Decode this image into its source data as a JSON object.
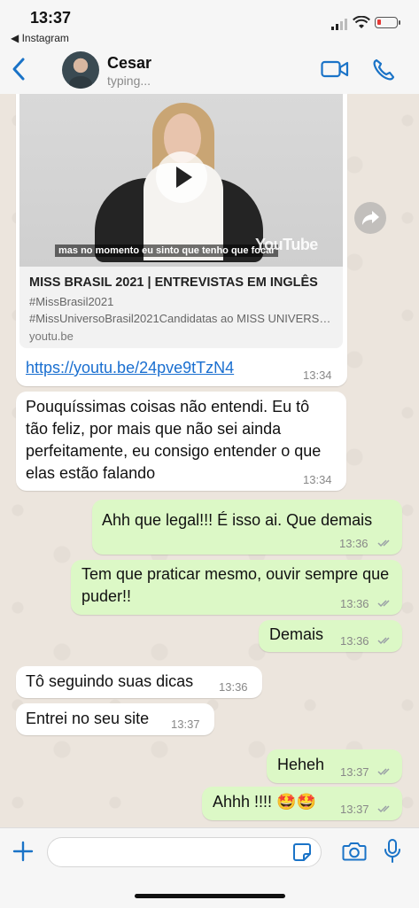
{
  "status_bar": {
    "time": "13:37",
    "back_app": "◀ Instagram"
  },
  "header": {
    "contact_name": "Cesar",
    "contact_status": "typing..."
  },
  "link_preview": {
    "video_caption": "mas no momento eu sinto que tenho que focar",
    "yt_logo": "YouTube",
    "title": "MISS BRASIL 2021 | ENTREVISTAS EM INGLÊS",
    "desc1": "#MissBrasil2021",
    "desc2": "#MissUniversoBrasil2021Candidatas ao MISS UNIVERSO...",
    "domain": "youtu.be",
    "url": "https://youtu.be/24pve9tTzN4",
    "time": "13:34"
  },
  "messages": [
    {
      "dir": "in",
      "text": "Pouquíssimas coisas não entendi. Eu tô tão feliz, por mais que não sei ainda perfeitamente, eu consigo entender o que elas estão falando",
      "time": "13:34"
    },
    {
      "dir": "out",
      "text": "Ahh que legal!!! É isso ai. Que demais",
      "time": "13:36"
    },
    {
      "dir": "out",
      "text": "Tem que praticar mesmo, ouvir sempre que puder!!",
      "time": "13:36"
    },
    {
      "dir": "out",
      "text": "Demais",
      "time": "13:36"
    },
    {
      "dir": "in",
      "text": "Tô seguindo suas dicas",
      "time": "13:36"
    },
    {
      "dir": "in",
      "text": "Entrei no seu site",
      "time": "13:37"
    },
    {
      "dir": "out",
      "text": "Heheh",
      "time": "13:37"
    },
    {
      "dir": "out",
      "text": "Ahhh !!!! 🤩🤩",
      "time": "13:37"
    }
  ],
  "colors": {
    "accent": "#1a73c7",
    "outgoing": "#dcf8c6",
    "incoming": "#ffffff",
    "read_ticks": "#9aa0a6"
  }
}
